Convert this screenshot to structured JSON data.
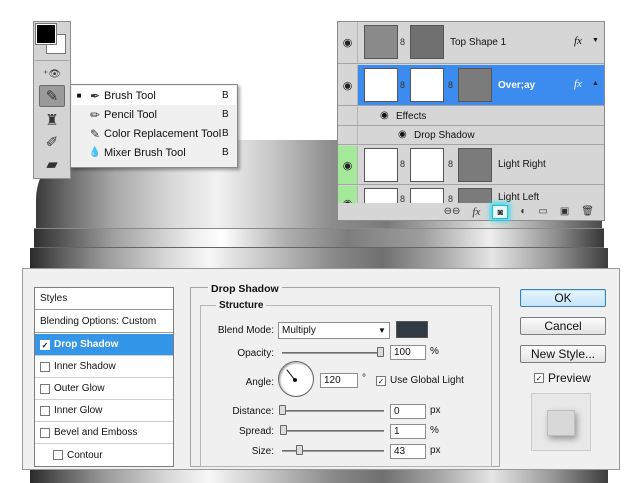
{
  "tools": {
    "foreground_color": "#000000",
    "background_color": "#ffffff",
    "items": [
      {
        "icon": "stamp-move-icon",
        "glyph": "⁺👁"
      },
      {
        "icon": "brush-icon",
        "glyph": "✎"
      },
      {
        "icon": "clone-stamp-icon",
        "glyph": "♜"
      },
      {
        "icon": "history-brush-icon",
        "glyph": "✐"
      },
      {
        "icon": "eraser-icon",
        "glyph": "▰"
      }
    ]
  },
  "brush_menu": {
    "items": [
      {
        "label": "Brush Tool",
        "key": "B",
        "icon": "brush-icon",
        "glyph": "✒",
        "selected": true
      },
      {
        "label": "Pencil Tool",
        "key": "B",
        "icon": "pencil-icon",
        "glyph": "✏",
        "selected": false
      },
      {
        "label": "Color Replacement Tool",
        "key": "B",
        "icon": "color-replacement-icon",
        "glyph": "✎",
        "selected": false
      },
      {
        "label": "Mixer Brush Tool",
        "key": "B",
        "icon": "mixer-brush-icon",
        "glyph": "💧",
        "selected": false
      }
    ]
  },
  "layers": {
    "rows": [
      {
        "name": "Top Shape 1",
        "fx": "fx",
        "has_eye": true,
        "selected": false
      },
      {
        "name": "Over;ay",
        "fx": "fx",
        "has_eye": true,
        "selected": true
      },
      {
        "name": "Light Right",
        "fx": "",
        "has_eye": true,
        "selected": false
      },
      {
        "name": "Light Left",
        "fx": "",
        "has_eye": true,
        "selected": false
      }
    ],
    "effects_label": "Effects",
    "effect_item": "Drop Shadow",
    "footer_icons": [
      "link-icon",
      "fx-icon",
      "add-mask-icon",
      "adjustment-icon",
      "folder-icon",
      "new-layer-icon",
      "trash-icon"
    ],
    "footer_fx": "fx",
    "selected_color": "#3c8cf0",
    "visible_highlight_color": "#a4e89a"
  },
  "dialog": {
    "styles_header": "Styles",
    "blending_options": "Blending Options: Custom",
    "style_items": [
      {
        "label": "Drop Shadow",
        "checked": true,
        "selected": true,
        "indent": false
      },
      {
        "label": "Inner Shadow",
        "checked": false,
        "selected": false,
        "indent": false
      },
      {
        "label": "Outer Glow",
        "checked": false,
        "selected": false,
        "indent": false
      },
      {
        "label": "Inner Glow",
        "checked": false,
        "selected": false,
        "indent": false
      },
      {
        "label": "Bevel and Emboss",
        "checked": false,
        "selected": false,
        "indent": false
      },
      {
        "label": "Contour",
        "checked": false,
        "selected": false,
        "indent": true
      }
    ],
    "section_title": "Drop Shadow",
    "structure_title": "Structure",
    "blend_mode": {
      "label": "Blend Mode:",
      "value": "Multiply",
      "color": "#2f3a45"
    },
    "opacity": {
      "label": "Opacity:",
      "value": "100",
      "unit": "%",
      "level": 1.0
    },
    "angle": {
      "label": "Angle:",
      "value": "120",
      "unit": "°"
    },
    "use_global_light": {
      "label": "Use Global Light",
      "checked": true
    },
    "distance": {
      "label": "Distance:",
      "value": "0",
      "unit": "px",
      "level": 0.0
    },
    "spread": {
      "label": "Spread:",
      "value": "1",
      "unit": "%",
      "level": 0.01
    },
    "size": {
      "label": "Size:",
      "value": "43",
      "unit": "px",
      "level": 0.17
    },
    "buttons": {
      "ok": "OK",
      "cancel": "Cancel",
      "new_style": "New Style..."
    },
    "preview": {
      "label": "Preview",
      "checked": true
    }
  }
}
